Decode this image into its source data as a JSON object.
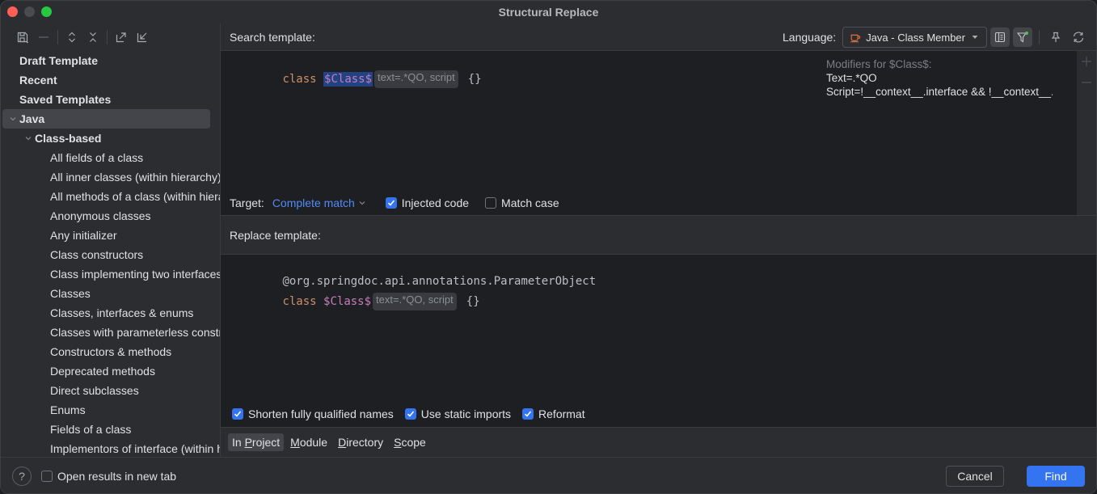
{
  "window": {
    "title": "Structural Replace"
  },
  "left_toolbar": {
    "icons": [
      "save-icon",
      "remove-icon",
      "expand-all-icon",
      "collapse-all-icon",
      "export-icon",
      "import-icon"
    ]
  },
  "tree": {
    "items": [
      {
        "label": "Draft Template",
        "level": 0,
        "bold": true
      },
      {
        "label": "Recent",
        "level": 0,
        "bold": true
      },
      {
        "label": "Saved Templates",
        "level": 0,
        "bold": true
      },
      {
        "label": "Java",
        "level": 0,
        "bold": true,
        "expanded": true,
        "selected": true
      },
      {
        "label": "Class-based",
        "level": 1,
        "bold": true,
        "expanded": true
      },
      {
        "label": "All fields of a class",
        "level": 2
      },
      {
        "label": "All inner classes (within hierarchy)",
        "level": 2
      },
      {
        "label": "All methods of a class (within hierarchy)",
        "level": 2
      },
      {
        "label": "Anonymous classes",
        "level": 2
      },
      {
        "label": "Any initializer",
        "level": 2
      },
      {
        "label": "Class constructors",
        "level": 2
      },
      {
        "label": "Class implementing two interfaces",
        "level": 2
      },
      {
        "label": "Classes",
        "level": 2
      },
      {
        "label": "Classes, interfaces & enums",
        "level": 2
      },
      {
        "label": "Classes with parameterless constructors",
        "level": 2
      },
      {
        "label": "Constructors & methods",
        "level": 2
      },
      {
        "label": "Deprecated methods",
        "level": 2
      },
      {
        "label": "Direct subclasses",
        "level": 2
      },
      {
        "label": "Enums",
        "level": 2
      },
      {
        "label": "Fields of a class",
        "level": 2
      },
      {
        "label": "Implementors of interface (within hierarchy)",
        "level": 2
      }
    ]
  },
  "search": {
    "label": "Search template:",
    "language_label": "Language:",
    "language_value": "Java - Class Member",
    "code": {
      "keyword": "class",
      "variable": "$Class$",
      "hint": "text=.*QO, script",
      "braces": "{}"
    },
    "modifiers": {
      "title": "Modifiers for $Class$:",
      "text": "Text=.*QO",
      "script": "Script=!__context__.interface && !__context__.enum"
    }
  },
  "target": {
    "label": "Target:",
    "value": "Complete match",
    "injected_code": {
      "label": "Injected code",
      "checked": true
    },
    "match_case": {
      "label": "Match case",
      "checked": false
    }
  },
  "replace": {
    "label": "Replace template:",
    "code": {
      "annotation": "@org.springdoc.api.annotations.ParameterObject",
      "keyword": "class",
      "variable": "$Class$",
      "hint": "text=.*QO, script",
      "braces": "{}"
    }
  },
  "options": {
    "shorten": {
      "label": "Shorten fully qualified names",
      "checked": true
    },
    "static_imports": {
      "label": "Use static imports",
      "checked": true
    },
    "reformat": {
      "label": "Reformat",
      "checked": true
    }
  },
  "scope": {
    "tabs": [
      {
        "pre": "In ",
        "mnemonic": "P",
        "post": "roject",
        "active": true
      },
      {
        "pre": "",
        "mnemonic": "M",
        "post": "odule",
        "active": false
      },
      {
        "pre": "",
        "mnemonic": "D",
        "post": "irectory",
        "active": false
      },
      {
        "pre": "",
        "mnemonic": "S",
        "post": "cope",
        "active": false
      }
    ]
  },
  "footer": {
    "help": "?",
    "open_new_tab": {
      "label": "Open results in new tab",
      "checked": false
    },
    "cancel": "Cancel",
    "find": "Find"
  },
  "colors": {
    "accent": "#3574f0",
    "link": "#548af7",
    "keyword": "#cf8e6d",
    "variable": "#c77dbb",
    "selection": "#214283"
  }
}
